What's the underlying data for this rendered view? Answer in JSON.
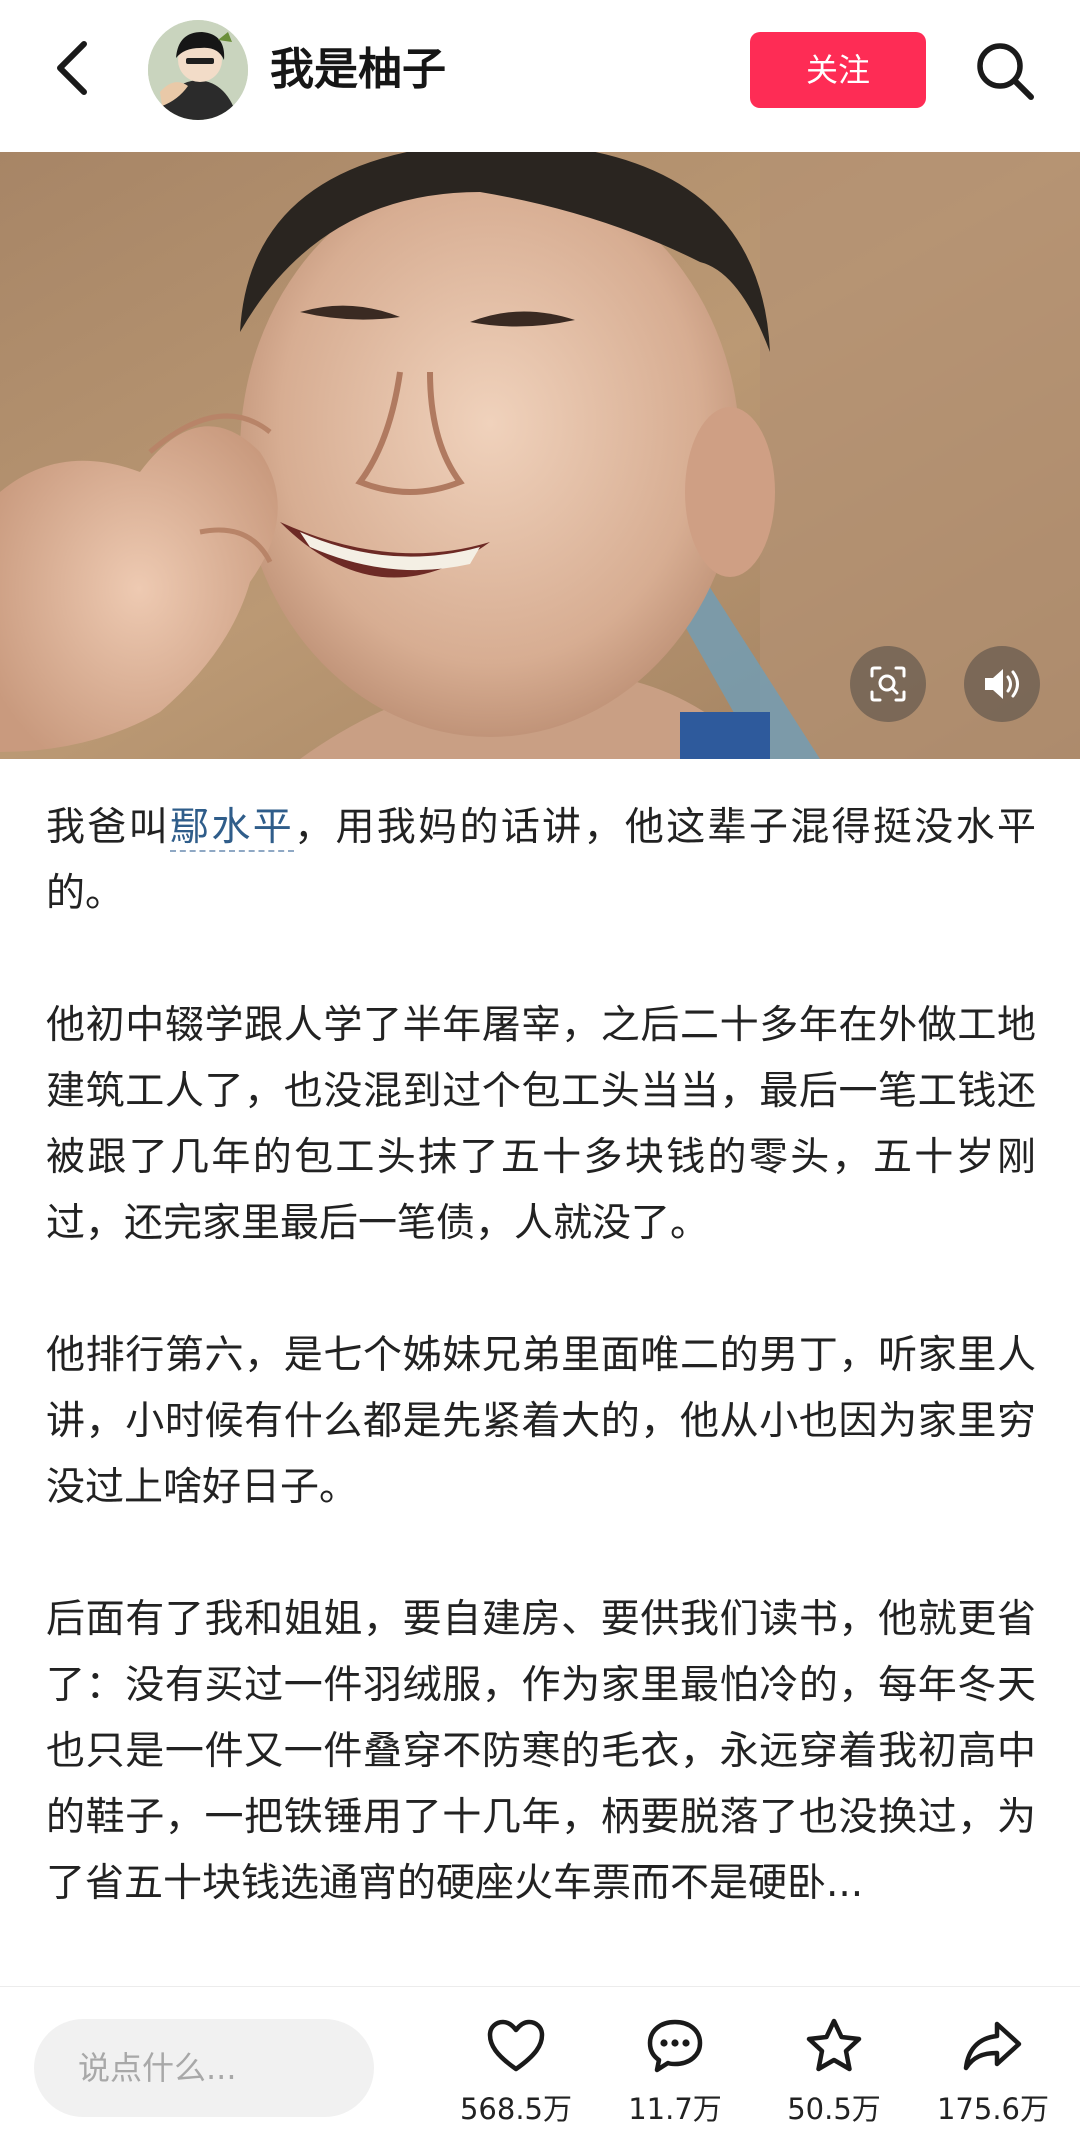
{
  "header": {
    "username": "我是柚子",
    "follow_label": "关注"
  },
  "article": {
    "p1_before": "我爸叫",
    "p1_link": "鄢水平",
    "p1_after": "，用我妈的话讲，他这辈子混得挺没水平的。",
    "p2": "他初中辍学跟人学了半年屠宰，之后二十多年在外做工地建筑工人了，也没混到过个包工头当当，最后一笔工钱还被跟了几年的包工头抹了五十多块钱的零头，五十岁刚过，还完家里最后一笔债，人就没了。",
    "p3": "他排行第六，是七个姊妹兄弟里面唯二的男丁，听家里人讲，小时候有什么都是先紧着大的，他从小也因为家里穷没过上啥好日子。",
    "p4": "后面有了我和姐姐，要自建房、要供我们读书，他就更省了：没有买过一件羽绒服，作为家里最怕冷的，每年冬天也只是一件又一件叠穿不防寒的毛衣，永远穿着我初高中的鞋子，一把铁锤用了十几年，柄要脱落了也没换过，为了省五十块钱选通宵的硬座火车票而不是硬卧..."
  },
  "bottom": {
    "comment_placeholder": "说点什么...",
    "likes": "568.5万",
    "comments": "11.7万",
    "favorites": "50.5万",
    "shares": "175.6万"
  },
  "colors": {
    "follow_bg": "#fe2c55",
    "link": "#2f5d8a"
  },
  "icons": [
    "back-icon",
    "search-icon",
    "image-search-icon",
    "volume-icon",
    "heart-icon",
    "comment-icon",
    "star-icon",
    "share-icon"
  ]
}
